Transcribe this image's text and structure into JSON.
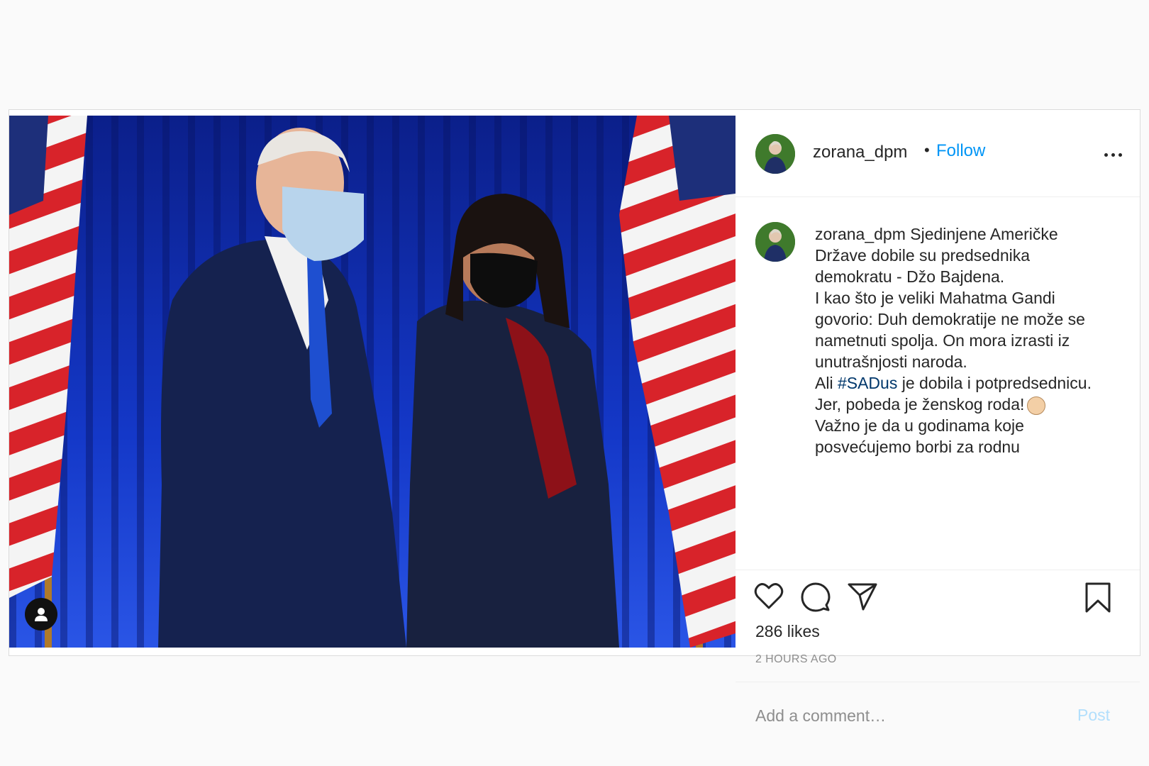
{
  "post": {
    "username": "zorana_dpm",
    "follow_dot": "•",
    "follow_label": "Follow",
    "caption_lines": [
      "Sjedinjene Američke",
      "Države dobile su predsednika",
      "demokratu - Džo Bajdena.",
      "I kao što je veliki Mahatma Gandi",
      "govorio: Duh demokratije ne može se",
      "nametnuti spolja. On mora izrasti iz",
      "unutrašnjosti naroda."
    ],
    "caption_line8_pre": "Ali ",
    "hashtag": "#SADus",
    "caption_line8_post": " je dobila i potpredsednicu.",
    "caption_line9": "Jer, pobeda je ženskog roda!",
    "caption_line10": "Važno je da u godinama koje",
    "caption_line11": "posvećujemo borbi za rodnu",
    "likes": "286 likes",
    "time_ago": "2 HOURS AGO",
    "comment_placeholder": "Add a comment…",
    "post_label": "Post"
  },
  "icons": {
    "like": "heart-icon",
    "comment": "comment-icon",
    "share": "share-icon",
    "save": "bookmark-icon",
    "more": "more-options-icon",
    "tag": "user-tag-icon",
    "emoji": "clapping-hands-emoji"
  },
  "colors": {
    "follow": "#0095f6",
    "hashtag": "#00376b",
    "post_disabled": "#b2dffc",
    "muted": "#8e8e8e"
  }
}
